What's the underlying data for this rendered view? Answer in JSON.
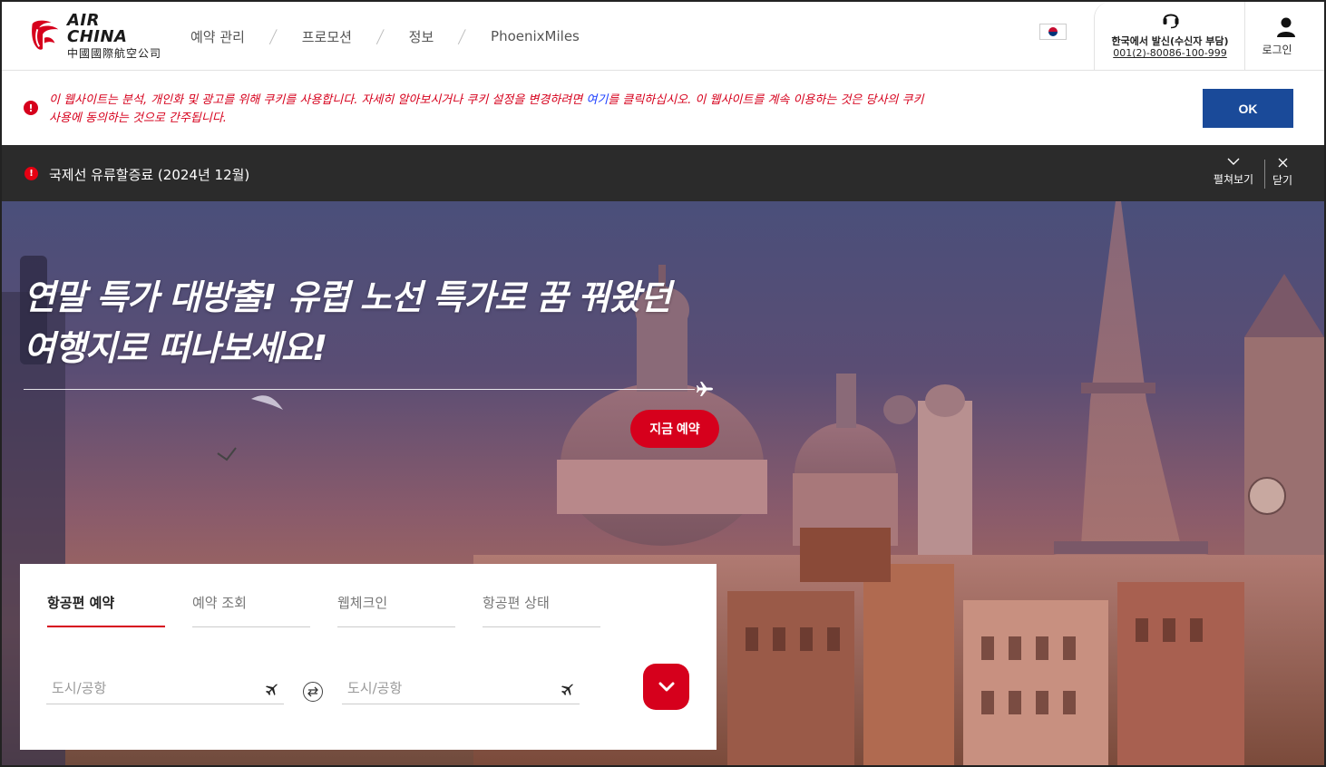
{
  "header": {
    "logo_en": "AIR CHINA",
    "logo_cn": "中國國際航空公司",
    "nav": [
      "예약 관리",
      "프로모션",
      "정보",
      "PhoenixMiles"
    ],
    "phone_label": "한국에서 발신(수신자 부담)",
    "phone_number": "001(2)-80086-100-999",
    "login_label": "로그인"
  },
  "cookie": {
    "text_before": "이 웹사이트는 분석, 개인화 및 광고를 위해 쿠키를 사용합니다. 자세히 알아보시거나 쿠키 설정을 변경하려면 ",
    "link": "여기",
    "text_after": "를 클릭하십시오. 이 웹사이트를 계속 이용하는 것은 당사의 쿠키 사용에 동의하는 것으로 간주됩니다.",
    "ok_label": "OK"
  },
  "notice": {
    "text": "국제선 유류할증료 (2024년 12월)",
    "expand_label": "펼쳐보기",
    "close_label": "닫기"
  },
  "hero": {
    "headline_1": "연말 특가 대방출! 유럽 노선 특가로 꿈 꿔왔던",
    "headline_2": "여행지로 떠나보세요!",
    "book_label": "지금 예약"
  },
  "booking": {
    "tabs": [
      "항공편 예약",
      "예약 조회",
      "웹체크인",
      "항공편 상태"
    ],
    "origin_placeholder": "도시/공항",
    "destination_placeholder": "도시/공항"
  },
  "colors": {
    "brand_red": "#d6001c",
    "brand_blue": "#1a4a99",
    "notice_bg": "#2b2b2b"
  }
}
